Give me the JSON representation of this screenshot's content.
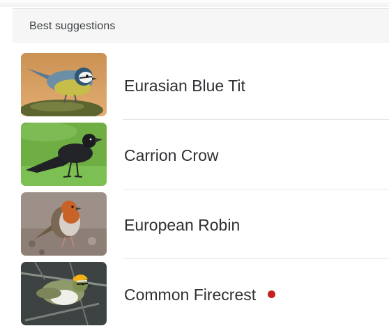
{
  "section": {
    "title": "Best suggestions"
  },
  "suggestions": [
    {
      "name": "Eurasian Blue Tit",
      "image_icon": "eurasian-blue-tit-photo-icon"
    },
    {
      "name": "Carrion Crow",
      "image_icon": "carrion-crow-photo-icon"
    },
    {
      "name": "European Robin",
      "image_icon": "european-robin-photo-icon"
    },
    {
      "name": "Common Firecrest",
      "image_icon": "common-firecrest-photo-icon",
      "status_dot": true
    }
  ],
  "colors": {
    "status_dot": "#c5221f",
    "header_background": "#f6f6f6",
    "divider": "#e6e6e6"
  }
}
